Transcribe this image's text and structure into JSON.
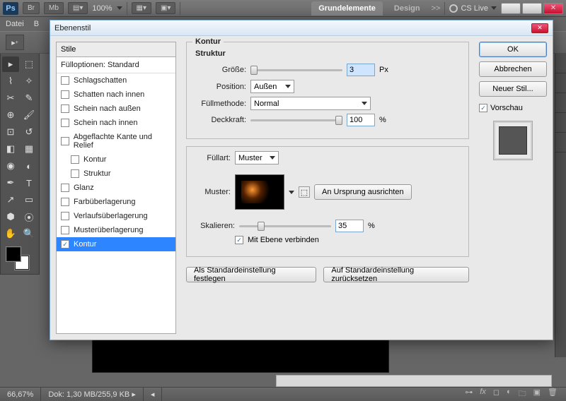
{
  "header": {
    "br": "Br",
    "mb": "Mb",
    "zoom": "100%",
    "tabs": {
      "grund": "Grundelemente",
      "design": "Design"
    },
    "more": ">>",
    "cslive": "CS Live"
  },
  "menu": {
    "datei": "Datei",
    "b": "B"
  },
  "dialog": {
    "title": "Ebenenstil",
    "styles_header": "Stile",
    "blend_options": "Fülloptionen: Standard",
    "styles": [
      {
        "label": "Schlagschatten",
        "checked": false,
        "indent": false
      },
      {
        "label": "Schatten nach innen",
        "checked": false,
        "indent": false
      },
      {
        "label": "Schein nach außen",
        "checked": false,
        "indent": false
      },
      {
        "label": "Schein nach innen",
        "checked": false,
        "indent": false
      },
      {
        "label": "Abgeflachte Kante und Relief",
        "checked": false,
        "indent": false
      },
      {
        "label": "Kontur",
        "checked": false,
        "indent": true
      },
      {
        "label": "Struktur",
        "checked": false,
        "indent": true
      },
      {
        "label": "Glanz",
        "checked": false,
        "indent": false
      },
      {
        "label": "Farbüberlagerung",
        "checked": false,
        "indent": false
      },
      {
        "label": "Verlaufsüberlagerung",
        "checked": false,
        "indent": false
      },
      {
        "label": "Musterüberlagerung",
        "checked": false,
        "indent": false
      },
      {
        "label": "Kontur",
        "checked": true,
        "indent": false,
        "selected": true
      }
    ],
    "kontur": {
      "legend": "Kontur",
      "struktur": "Struktur",
      "size_label": "Größe:",
      "size_value": "3",
      "size_unit": "Px",
      "position_label": "Position:",
      "position_value": "Außen",
      "blend_label": "Füllmethode:",
      "blend_value": "Normal",
      "opacity_label": "Deckkraft:",
      "opacity_value": "100",
      "opacity_unit": "%",
      "filltype_label": "Füllart:",
      "filltype_value": "Muster",
      "pattern_label": "Muster:",
      "snap_btn": "An Ursprung ausrichten",
      "scale_label": "Skalieren:",
      "scale_value": "35",
      "scale_unit": "%",
      "link_label": "Mit Ebene verbinden",
      "link_checked": true,
      "make_default": "Als Standardeinstellung festlegen",
      "reset_default": "Auf Standardeinstellung zurücksetzen"
    },
    "buttons": {
      "ok": "OK",
      "cancel": "Abbrechen",
      "new_style": "Neuer Stil...",
      "preview": "Vorschau"
    }
  },
  "status": {
    "zoom": "66,67%",
    "doc": "Dok: 1,30 MB/255,9 KB"
  }
}
